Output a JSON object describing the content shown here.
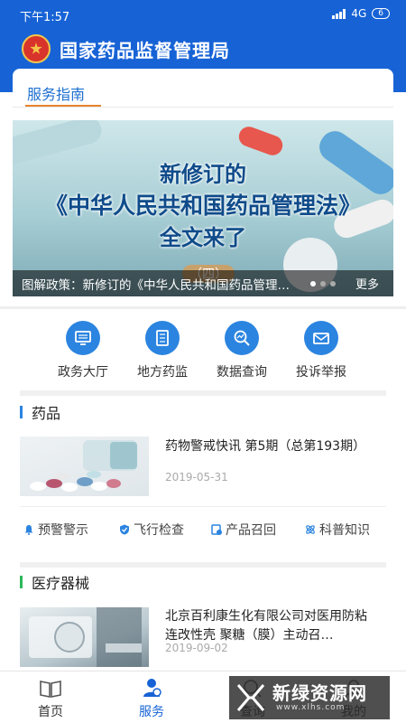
{
  "status_bar": {
    "time": "下午1:57",
    "network": "4G",
    "battery": "6"
  },
  "header": {
    "title": "国家药品监督管理局"
  },
  "guide": {
    "tab_label": "服务指南"
  },
  "banner": {
    "line1": "新修订的",
    "line2": "《中华人民共和国药品管理法》",
    "line3": "全文来了",
    "line4": "（四）",
    "caption": "图解政策：新修订的《中华人民共和国药品管理法》",
    "more_label": "更多"
  },
  "quick_links": [
    {
      "label": "政务大厅",
      "icon": "monitor-icon"
    },
    {
      "label": "地方药监",
      "icon": "notebook-icon"
    },
    {
      "label": "数据查询",
      "icon": "magnifier-chart-icon"
    },
    {
      "label": "投诉举报",
      "icon": "mail-icon"
    }
  ],
  "drugs_section": {
    "title": "药品",
    "item": {
      "title": "药物警戒快讯 第5期（总第193期）",
      "date": "2019-05-31"
    },
    "categories": [
      {
        "label": "预警警示",
        "icon": "bell-icon"
      },
      {
        "label": "飞行检查",
        "icon": "shield-check-icon"
      },
      {
        "label": "产品召回",
        "icon": "recall-icon"
      },
      {
        "label": "科普知识",
        "icon": "atom-icon"
      }
    ]
  },
  "devices_section": {
    "title": "医疗器械",
    "item": {
      "title": "北京百利康生化有限公司对医用防粘连改性壳 聚糖（膜）主动召…",
      "date": "2019-09-02"
    }
  },
  "bottom_nav": [
    {
      "label": "首页",
      "icon": "book-icon"
    },
    {
      "label": "服务",
      "icon": "person-icon"
    },
    {
      "label": "查询",
      "icon": "search-icon"
    },
    {
      "label": "我的",
      "icon": "user-icon"
    }
  ],
  "watermark": {
    "text": "新绿资源网",
    "url": "www.xlhs.com"
  },
  "colors": {
    "primary": "#1763d6",
    "accent": "#2b84e0",
    "tab_underline": "#e8832c",
    "green": "#2eb85c"
  }
}
